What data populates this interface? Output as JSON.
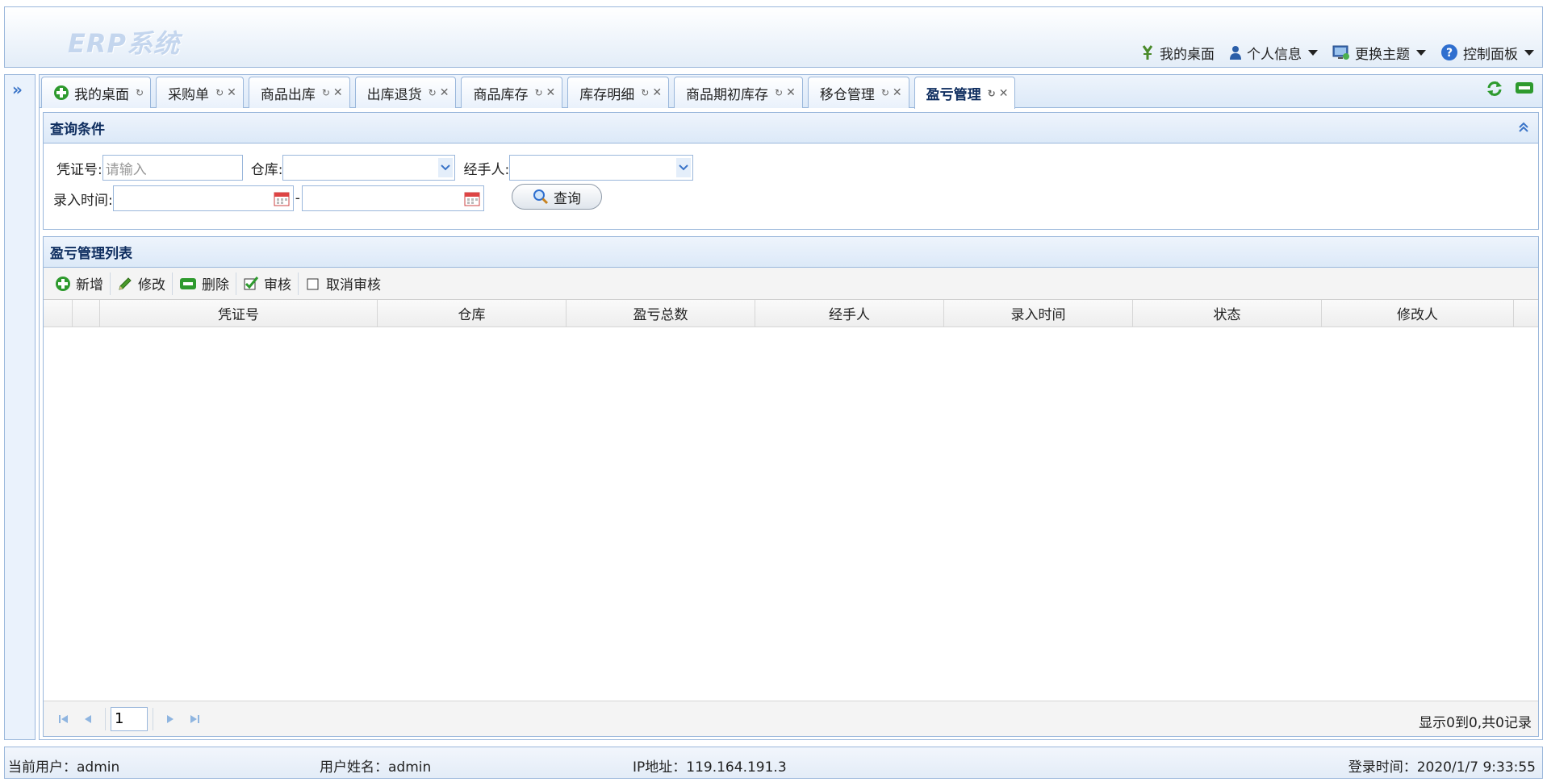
{
  "app": {
    "logo": "ERP系统"
  },
  "topmenu": [
    {
      "label": "我的桌面",
      "icon": "desktop-icon"
    },
    {
      "label": "个人信息",
      "icon": "user-icon"
    },
    {
      "label": "更换主题",
      "icon": "theme-icon"
    },
    {
      "label": "控制面板",
      "icon": "help-icon"
    }
  ],
  "tabs": [
    {
      "label": "我的桌面",
      "closable": false,
      "active": false
    },
    {
      "label": "采购单",
      "closable": true,
      "active": false
    },
    {
      "label": "商品出库",
      "closable": true,
      "active": false
    },
    {
      "label": "出库退货",
      "closable": true,
      "active": false
    },
    {
      "label": "商品库存",
      "closable": true,
      "active": false
    },
    {
      "label": "库存明细",
      "closable": true,
      "active": false
    },
    {
      "label": "商品期初库存",
      "closable": true,
      "active": false
    },
    {
      "label": "移仓管理",
      "closable": true,
      "active": false
    },
    {
      "label": "盈亏管理",
      "closable": true,
      "active": true
    }
  ],
  "query": {
    "title": "查询条件",
    "voucher_label": "凭证号:",
    "voucher_placeholder": "请输入",
    "warehouse_label": "仓库:",
    "handler_label": "经手人:",
    "time_label": "录入时间:",
    "range_sep": "-",
    "search_button": "查询"
  },
  "list": {
    "title": "盈亏管理列表",
    "toolbar": {
      "add": "新增",
      "edit": "修改",
      "delete": "删除",
      "audit": "审核",
      "cancel_audit": "取消审核"
    },
    "columns": [
      "凭证号",
      "仓库",
      "盈亏总数",
      "经手人",
      "录入时间",
      "状态",
      "修改人"
    ],
    "rows": []
  },
  "pager": {
    "page": "1",
    "info": "显示0到0,共0记录"
  },
  "footer": {
    "current_user": "当前用户：admin",
    "user_name": "用户姓名：admin",
    "ip": "IP地址：119.164.191.3",
    "login_time": "登录时间：2020/1/7 9:33:55"
  },
  "colors": {
    "border": "#9ab7db",
    "header_bg": "#dce9f8",
    "title": "#0e2d5f",
    "accent_green": "#2e9a2e"
  }
}
